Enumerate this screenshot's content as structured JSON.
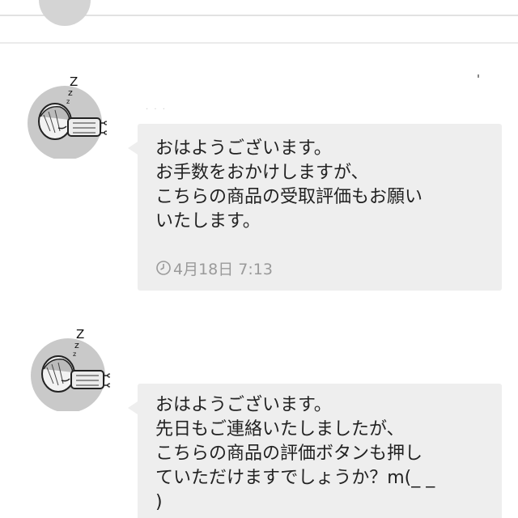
{
  "messages": [
    {
      "lines": [
        "おはようございます。",
        "お手数をおかけしますが、",
        "こちらの商品の受取評価もお願い",
        "いたします。"
      ],
      "timestamp": "4月18日 7:13"
    },
    {
      "lines": [
        "おはようございます。",
        "先日もご連絡いたしましたが、",
        "こちらの商品の評価ボタンも押し",
        "ていただけますでしょうか？m(_ _",
        ")"
      ]
    }
  ],
  "icons": {
    "avatar": "sleeping-person-avatar",
    "timestamp": "clock-icon"
  },
  "colors": {
    "bubble": "#eeeeee",
    "text": "#222222",
    "timestamp": "#9a9a9a",
    "avatar_bg": "#c9c9c9"
  }
}
